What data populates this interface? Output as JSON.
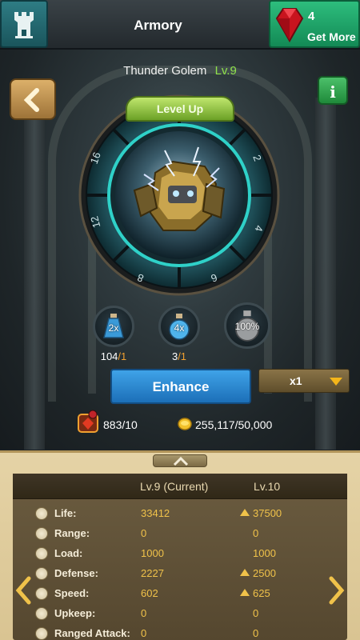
{
  "header": {
    "title": "Armory",
    "home_icon": "tower-icon",
    "currency_count": "4",
    "get_more_label": "Get More",
    "currency_icon": "red-gem-icon"
  },
  "hero": {
    "name": "Thunder Golem",
    "level": "Lv.9",
    "level_up_label": "Level Up",
    "dial_numbers": [
      "2",
      "4",
      "6",
      "8",
      "12",
      "16"
    ]
  },
  "potions": [
    {
      "multiplier": "2x",
      "count": "104",
      "den": "/1",
      "icon": "blue-potion-icon"
    },
    {
      "multiplier": "4x",
      "count": "3",
      "den": "/1",
      "icon": "blue-flask-icon"
    },
    {
      "multiplier": "100%",
      "count": "",
      "den": "",
      "icon": "grey-flask-icon"
    }
  ],
  "actions": {
    "enhance_label": "Enhance",
    "multiplier_value": "x1"
  },
  "resources": {
    "gems_text": "883/10",
    "gold_text": "255,117/50,000"
  },
  "stats": {
    "col_current": "Lv.9 (Current)",
    "col_next": "Lv.10",
    "rows": [
      {
        "label": "Life:",
        "current": "33412",
        "next": "37500",
        "up": true
      },
      {
        "label": "Range:",
        "current": "0",
        "next": "0",
        "up": false
      },
      {
        "label": "Load:",
        "current": "1000",
        "next": "1000",
        "up": false
      },
      {
        "label": "Defense:",
        "current": "2227",
        "next": "2500",
        "up": true
      },
      {
        "label": "Speed:",
        "current": "602",
        "next": "625",
        "up": true
      },
      {
        "label": "Upkeep:",
        "current": "0",
        "next": "0",
        "up": false
      },
      {
        "label": "Ranged Attack:",
        "current": "0",
        "next": "0",
        "up": false
      }
    ]
  },
  "colors": {
    "accent_gold": "#f0c24a",
    "level_green": "#8fe24c",
    "enhance_blue": "#2a88d0",
    "get_more_green": "#1fa466"
  }
}
